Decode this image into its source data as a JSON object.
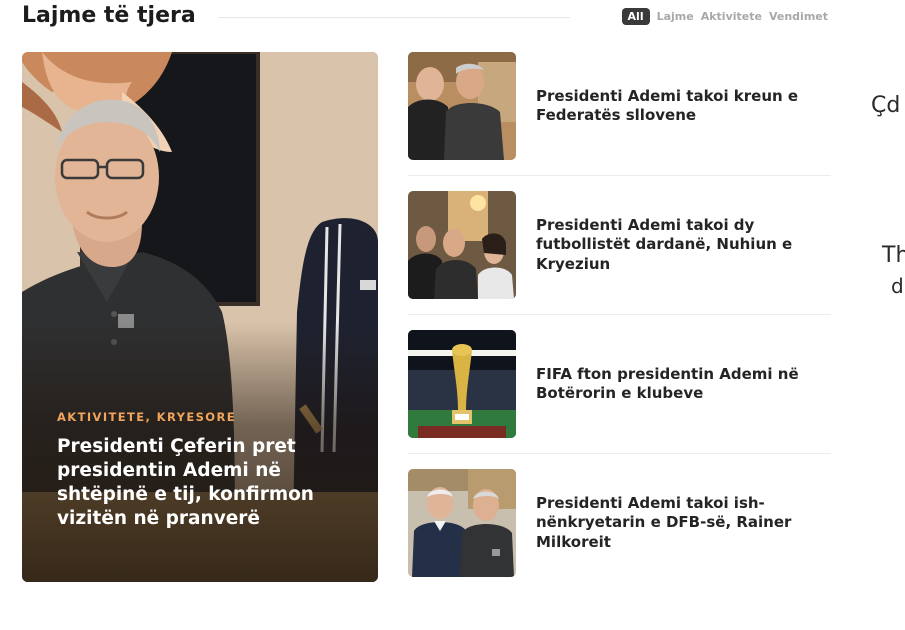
{
  "section": {
    "title": "Lajme të tjera",
    "filters": [
      {
        "label": "All",
        "active": true
      },
      {
        "label": "Lajme",
        "active": false
      },
      {
        "label": "Aktivitete",
        "active": false
      },
      {
        "label": "Vendimet",
        "active": false
      }
    ]
  },
  "featured": {
    "category": "AKTIVITETE, KRYESORE",
    "title": "Presidenti Çeferin pret presidentin Ademi në shtëpinë e tij, konfirmon vizitën në pranverë",
    "accent_color": "#f0a45c"
  },
  "news": [
    {
      "title": "Presidenti Ademi takoi kreun e Federatës sllovene"
    },
    {
      "title": "Presidenti Ademi takoi dy futbollistët dardanë, Nuhiun e Kryeziun"
    },
    {
      "title": "FIFA fton presidentin Ademi në Botërorin e klubeve"
    },
    {
      "title": "Presidenti Ademi takoi ish-nënkryetarin e DFB-së, Rainer Milkoreit"
    }
  ],
  "side_fragments": {
    "line1": "Çd",
    "line2": "Th",
    "line3": "d"
  }
}
